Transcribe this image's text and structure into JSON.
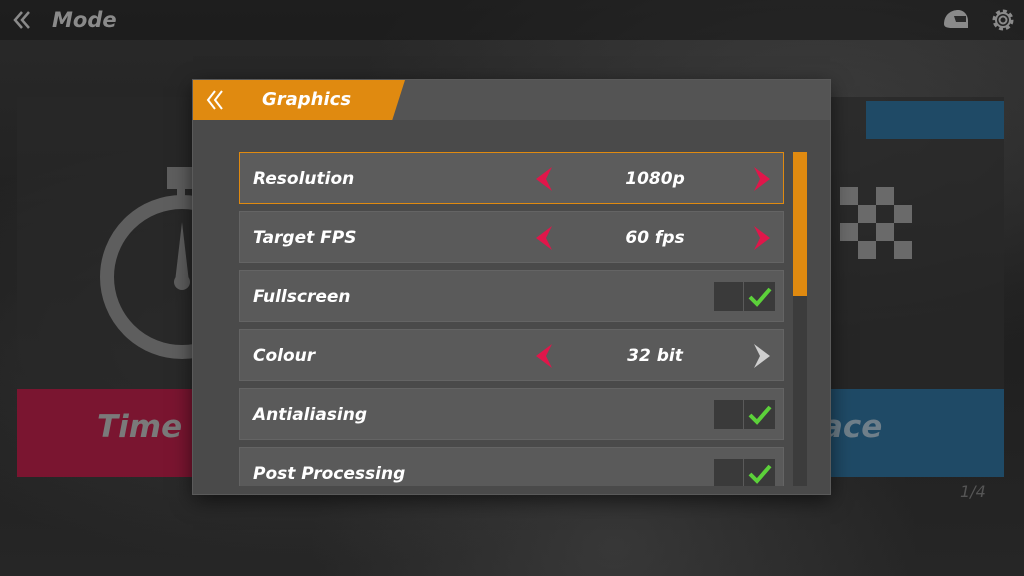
{
  "topbar": {
    "title": "Mode"
  },
  "background_cards": {
    "left_label": "Time Tria",
    "right_label": "ace",
    "page_indicator": "1/4"
  },
  "dialog": {
    "title": "Graphics",
    "rows": [
      {
        "label": "Resolution",
        "type": "selector",
        "value": "1080p",
        "selected": true
      },
      {
        "label": "Target FPS",
        "type": "selector",
        "value": "60 fps"
      },
      {
        "label": "Fullscreen",
        "type": "toggle",
        "checked": true
      },
      {
        "label": "Colour",
        "type": "selector",
        "value": "32 bit"
      },
      {
        "label": "Antialiasing",
        "type": "toggle",
        "checked": true
      },
      {
        "label": "Post Processing",
        "type": "toggle",
        "checked": true
      }
    ]
  },
  "colors": {
    "accent": "#e08a10",
    "arrow_active": "#e0164a",
    "arrow_disabled": "#cfcfcf",
    "check": "#5cd13a"
  }
}
